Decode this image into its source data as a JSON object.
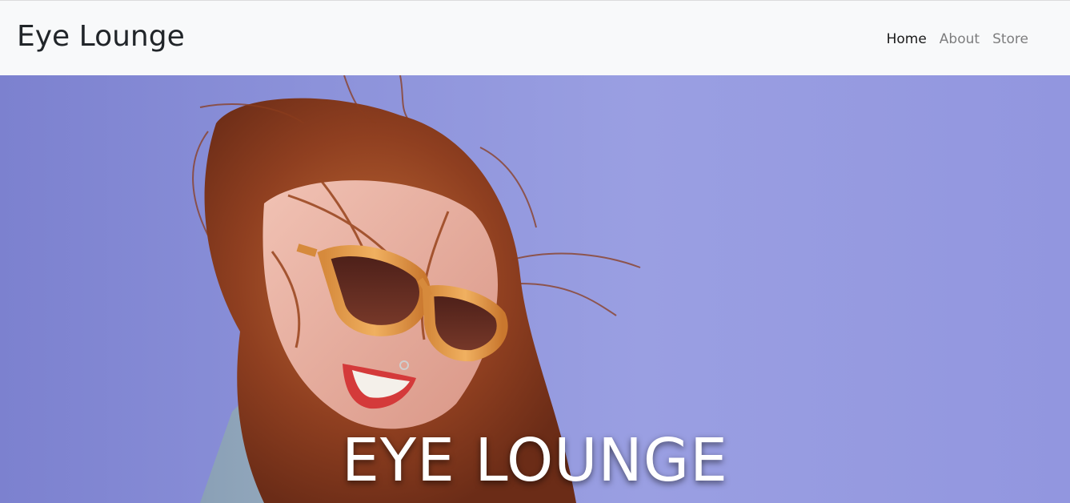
{
  "site": {
    "brand": "Eye Lounge"
  },
  "nav": {
    "items": [
      {
        "label": "Home",
        "active": true
      },
      {
        "label": "About",
        "active": false
      },
      {
        "label": "Store",
        "active": false
      }
    ]
  },
  "hero": {
    "title": "EYE LOUNGE",
    "background_color": "#8f94dd"
  }
}
